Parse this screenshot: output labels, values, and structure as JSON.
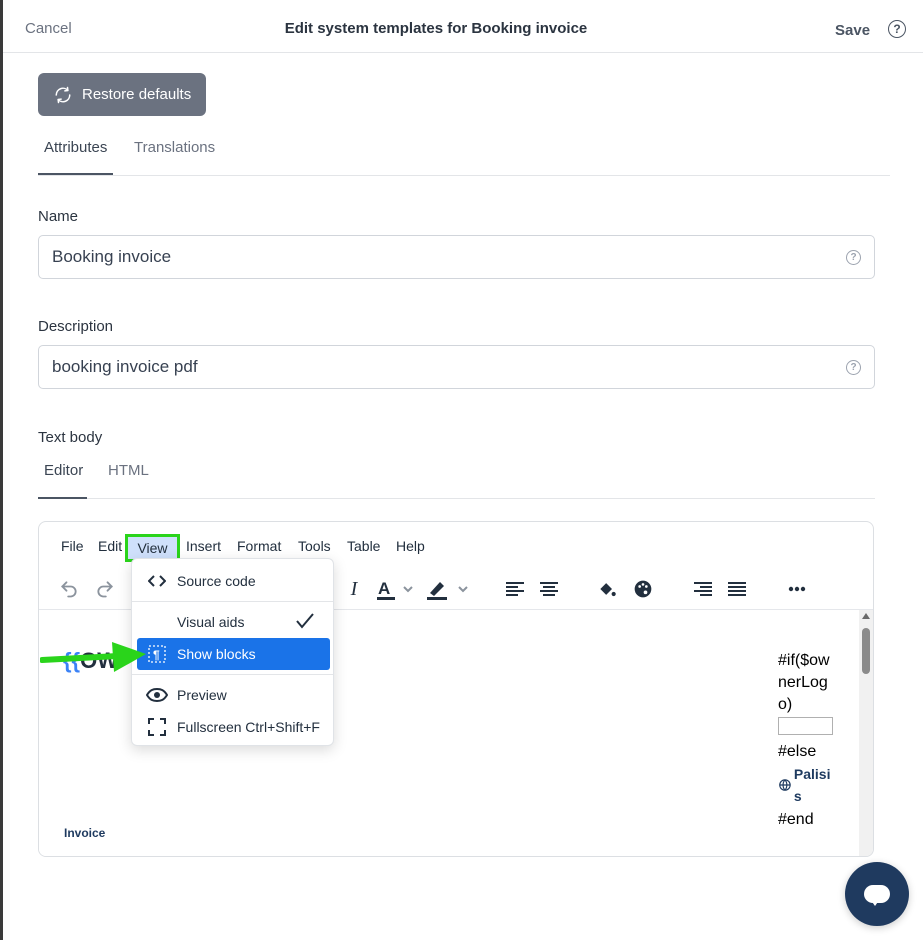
{
  "header": {
    "cancel_label": "Cancel",
    "title": "Edit system templates for Booking invoice",
    "save_label": "Save",
    "help_glyph": "?"
  },
  "restore": {
    "label": "Restore defaults"
  },
  "tabs": [
    {
      "label": "Attributes",
      "active": true
    },
    {
      "label": "Translations",
      "active": false
    }
  ],
  "fields": {
    "name": {
      "label": "Name",
      "value": "Booking invoice"
    },
    "description": {
      "label": "Description",
      "value": "booking invoice pdf"
    }
  },
  "text_body": {
    "label": "Text body",
    "subtabs": [
      {
        "label": "Editor",
        "active": true
      },
      {
        "label": "HTML",
        "active": false
      }
    ]
  },
  "editor": {
    "menu": [
      "File",
      "Edit",
      "View",
      "Insert",
      "Format",
      "Tools",
      "Table",
      "Help"
    ],
    "highlighted_menu": "View",
    "toolbar_icons": [
      "undo-icon",
      "redo-icon",
      "italic-icon",
      "text-color-icon",
      "highlight-icon",
      "align-left-icon",
      "align-center-icon",
      "fill-icon",
      "palette-icon",
      "align-right-icon",
      "justify-icon",
      "more-icon"
    ],
    "content": {
      "owner_prefix": "{{",
      "owner_text": "OW",
      "right_lines": [
        "#if($ownerLogo)"
      ],
      "else_text": "#else",
      "palisis_text": "Palisis",
      "end_text": "#end",
      "invoice_label": "Invoice"
    }
  },
  "view_menu": {
    "items": [
      {
        "label": "Source code",
        "icon": "code-icon"
      },
      {
        "label": "Visual aids",
        "icon": "",
        "checked": true
      },
      {
        "label": "Show blocks",
        "icon": "show-blocks-icon",
        "active": true
      },
      {
        "label": "Preview",
        "icon": "eye-icon"
      },
      {
        "label": "Fullscreen",
        "icon": "fullscreen-icon",
        "shortcut": "Ctrl+Shift+F"
      }
    ]
  },
  "colors": {
    "accent": "#1a73e8",
    "highlight_box": "#2ad41b",
    "chat": "#1f3a5f",
    "restore_bg": "#6b7280"
  }
}
